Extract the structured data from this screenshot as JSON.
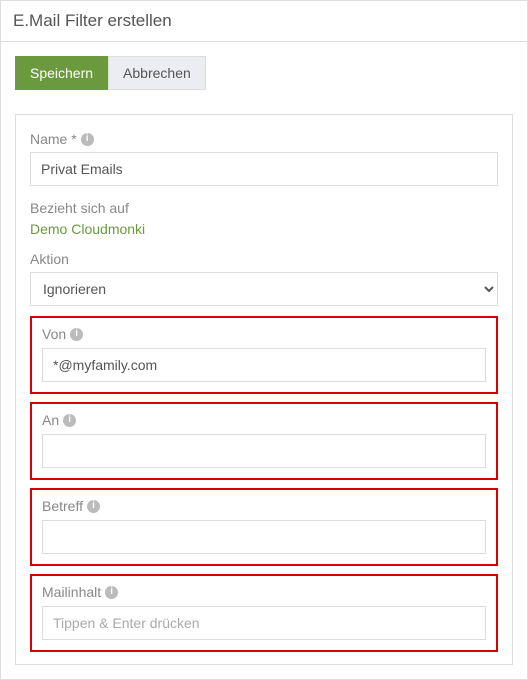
{
  "header": {
    "title": "E.Mail Filter erstellen"
  },
  "buttons": {
    "save": "Speichern",
    "cancel": "Abbrechen"
  },
  "form": {
    "name_label": "Name *",
    "name_value": "Privat Emails",
    "refers_label": "Bezieht sich auf",
    "refers_value": "Demo Cloudmonki",
    "action_label": "Aktion",
    "action_value": "Ignorieren",
    "from_label": "Von",
    "from_value": "*@myfamily.com",
    "to_label": "An",
    "to_value": "",
    "subject_label": "Betreff",
    "subject_value": "",
    "body_label": "Mailinhalt",
    "body_placeholder": "Tippen & Enter drücken",
    "body_value": ""
  },
  "icons": {
    "info_glyph": "i"
  }
}
